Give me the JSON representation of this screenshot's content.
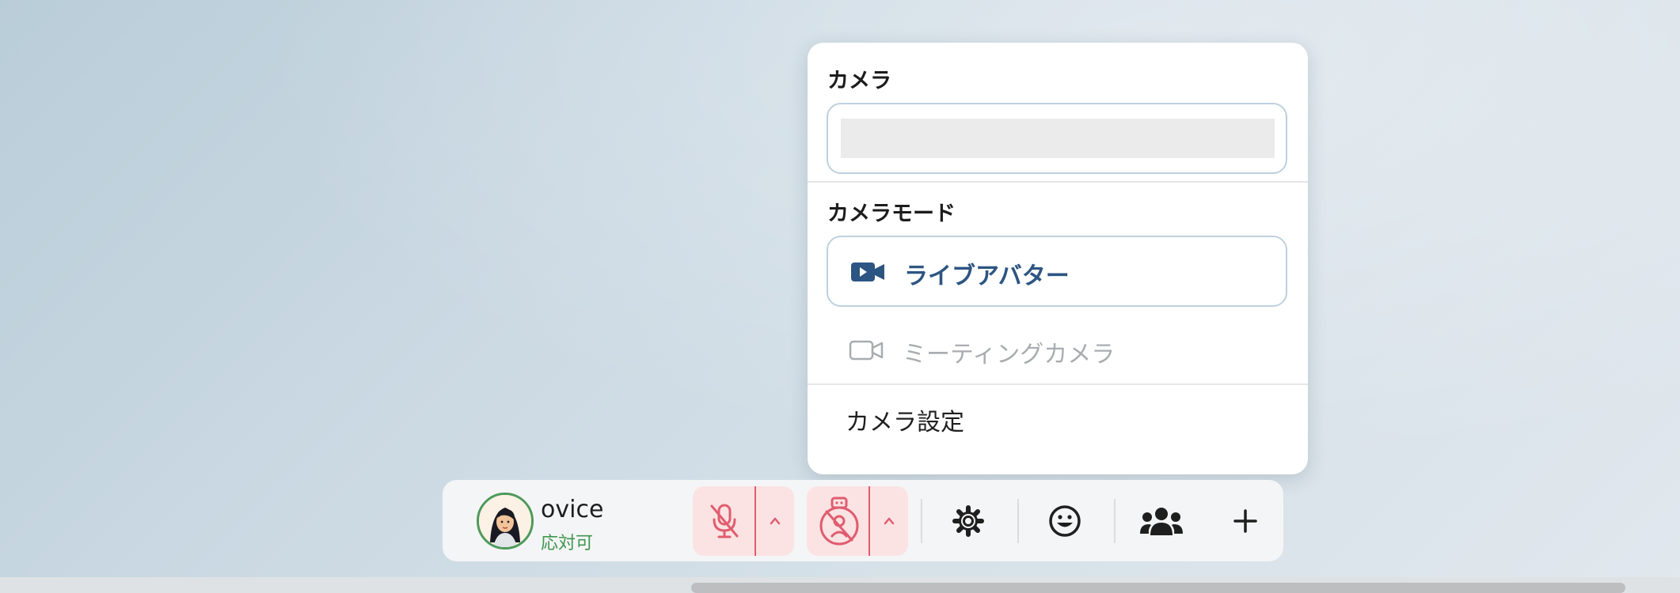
{
  "camera_popover": {
    "camera_section_title": "カメラ",
    "camera_select_value": "",
    "mode_section_title": "カメラモード",
    "modes": [
      {
        "label": "ライブアバター",
        "icon": "video-camera-filled-icon",
        "selected": true
      },
      {
        "label": "ミーティングカメラ",
        "icon": "video-camera-outline-icon",
        "selected": false
      }
    ],
    "settings_label": "カメラ設定"
  },
  "toolbar": {
    "user": {
      "name": "ovice",
      "status": "応対可",
      "avatar_icon": "user-avatar-icon"
    },
    "mic_button": {
      "icon": "mic-muted-icon",
      "state": "off"
    },
    "camera_button": {
      "icon": "avatar-camera-off-icon",
      "state": "off"
    },
    "settings_button": {
      "icon": "gear-icon"
    },
    "reaction_button": {
      "icon": "smiley-icon"
    },
    "people_button": {
      "icon": "people-icon"
    },
    "add_button": {
      "icon": "plus-icon"
    }
  },
  "colors": {
    "selected_mode": "#2d5583",
    "status_green": "#3f9650",
    "muted_red": "#e05d6f",
    "muted_bg": "#fbe3e3"
  }
}
